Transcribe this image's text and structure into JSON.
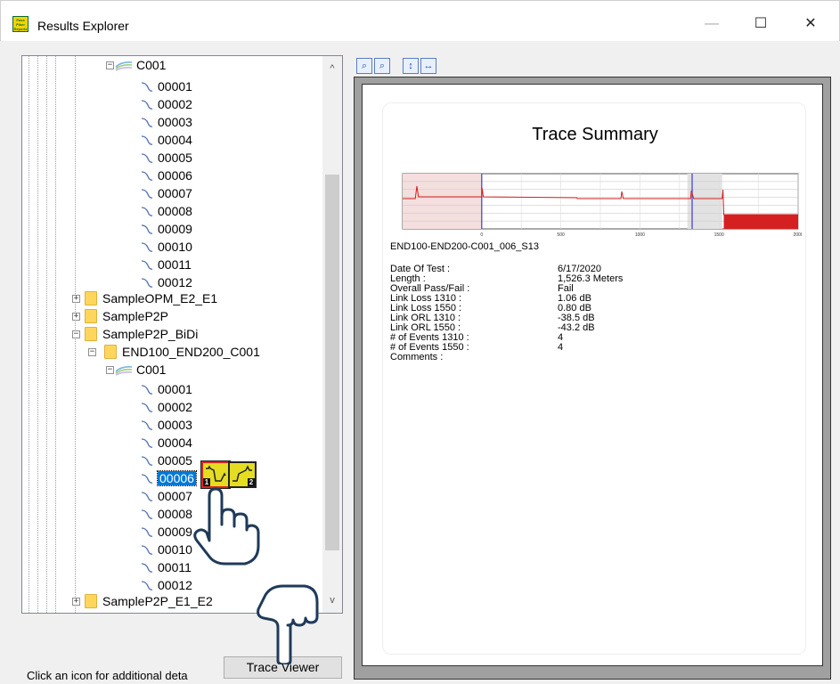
{
  "window": {
    "title": "Results Explorer",
    "icon_text": "Pass Fiber Reports",
    "minimize_glyph": "—",
    "maximize_glyph": "☐",
    "close_glyph": "✕"
  },
  "tree": {
    "top_group": {
      "cable": "C001",
      "traces": [
        "00001",
        "00002",
        "00003",
        "00004",
        "00005",
        "00006",
        "00007",
        "00008",
        "00009",
        "00010",
        "00011",
        "00012"
      ]
    },
    "folders": [
      "SampleOPM_E2_E1",
      "SampleP2P",
      "SampleP2P_BiDi"
    ],
    "subfolder": "END100_END200_C001",
    "bottom_group": {
      "cable": "C001",
      "traces": [
        "00001",
        "00002",
        "00003",
        "00004",
        "00005",
        "00006",
        "00007",
        "00008",
        "00009",
        "00010",
        "00011",
        "00012"
      ],
      "selected": "00006"
    },
    "last_folder": "SampleP2P_E1_E2",
    "event_icons": [
      "1",
      "2"
    ]
  },
  "scrollbar": {
    "up_glyph": "^",
    "down_glyph": "v"
  },
  "toolbar": {
    "zoom_icons": [
      "zoom-in-icon",
      "zoom-out-icon",
      "fit-vertical-icon",
      "fit-horizontal-icon"
    ]
  },
  "status": {
    "text": "Click an icon for additional deta",
    "trace_viewer_label": "Trace Viewer"
  },
  "report": {
    "title": "Trace Summary",
    "trace_name": "END100-END200-C001_006_S13",
    "rows": [
      {
        "label": "Date Of Test :",
        "value": "6/17/2020"
      },
      {
        "label": "Length :",
        "value": "1,526.3 Meters"
      },
      {
        "label": "Overall Pass/Fail :",
        "value": "Fail"
      },
      {
        "label": "Link Loss  1310  :",
        "value": "1.06  dB"
      },
      {
        "label": "Link Loss  1550  :",
        "value": "0.80  dB"
      },
      {
        "label": "Link ORL  1310  :",
        "value": "-38.5  dB"
      },
      {
        "label": "Link ORL  1550  :",
        "value": "-43.2  dB"
      },
      {
        "label": "# of Events   1310  :",
        "value": "4"
      },
      {
        "label": "# of Events   1550  :",
        "value": "4"
      },
      {
        "label": "Comments :",
        "value": ""
      }
    ]
  },
  "chart_data": {
    "type": "line",
    "xlim": [
      -500,
      2000
    ],
    "x_ticks": [
      "0",
      "500",
      "1000",
      "1500",
      "2000"
    ],
    "series": [
      {
        "color": "#d42020",
        "values": []
      }
    ],
    "trace_color": "#d42020",
    "marker_color": "#3a3adf"
  }
}
